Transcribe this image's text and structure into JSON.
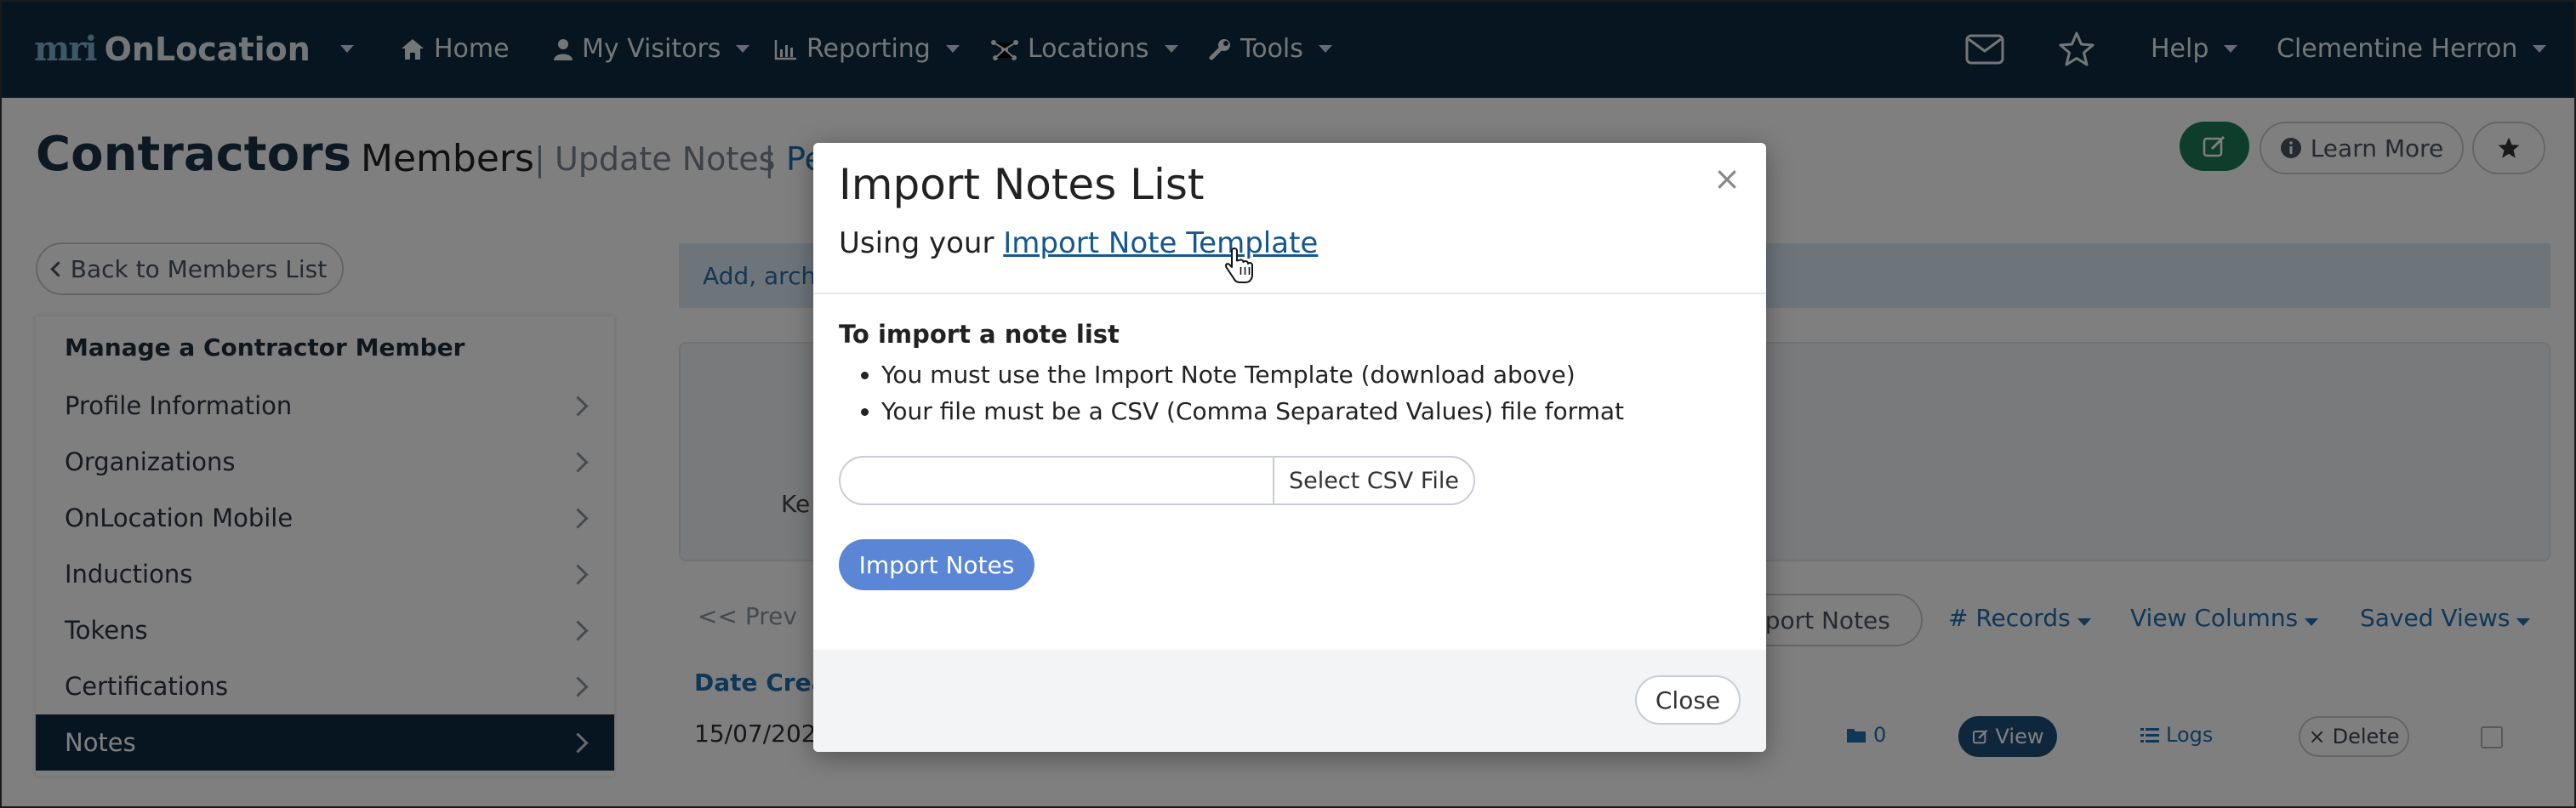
{
  "navbar": {
    "logo_mark": "mri",
    "logo_text": "OnLocation",
    "items": [
      {
        "icon": "home-icon",
        "label": "Home"
      },
      {
        "icon": "user-icon",
        "label": "My Visitors"
      },
      {
        "icon": "bar-chart-icon",
        "label": "Reporting"
      },
      {
        "icon": "network-icon",
        "label": "Locations"
      },
      {
        "icon": "wrench-icon",
        "label": "Tools"
      }
    ],
    "help_label": "Help",
    "user_name": "Clementine Herron"
  },
  "page": {
    "title": "Contractors",
    "members_label": "Members",
    "update_notes_label": "Update Notes",
    "partial_tab": "Pe",
    "learn_more_label": "Learn More",
    "back_label": "Back to Members List",
    "info_text": "Add, arch",
    "key_label": "Ke",
    "prev_label": "<< Prev",
    "export_label": "xport Notes",
    "records_label": "# Records",
    "view_columns_label": "View Columns",
    "saved_views_label": "Saved Views",
    "date_col": "Date Crea",
    "date_cell": "15/07/202",
    "folder_count": "0",
    "view_label": "View",
    "logs_label": "Logs",
    "delete_label": "Delete"
  },
  "sidebar": {
    "heading": "Manage a Contractor Member",
    "items": [
      {
        "label": "Profile Information"
      },
      {
        "label": "Organizations"
      },
      {
        "label": "OnLocation Mobile"
      },
      {
        "label": "Inductions"
      },
      {
        "label": "Tokens"
      },
      {
        "label": "Certifications"
      },
      {
        "label": "Notes",
        "active": true
      }
    ]
  },
  "modal": {
    "title": "Import Notes List",
    "close_x": "×",
    "using_prefix": "Using your",
    "template_link": "Import Note Template",
    "section_heading": "To import a note list",
    "bullets": [
      "You must use the Import Note Template (download above)",
      "Your file must be a CSV (Comma Separated Values) file format"
    ],
    "file_value": "",
    "select_file_label": "Select CSV File",
    "import_button": "Import Notes",
    "close_button": "Close"
  },
  "colors": {
    "navbar": "#0d2b3e",
    "accent_green": "#1e7a57",
    "import_button": "#5b86d6",
    "link": "#15578f"
  }
}
